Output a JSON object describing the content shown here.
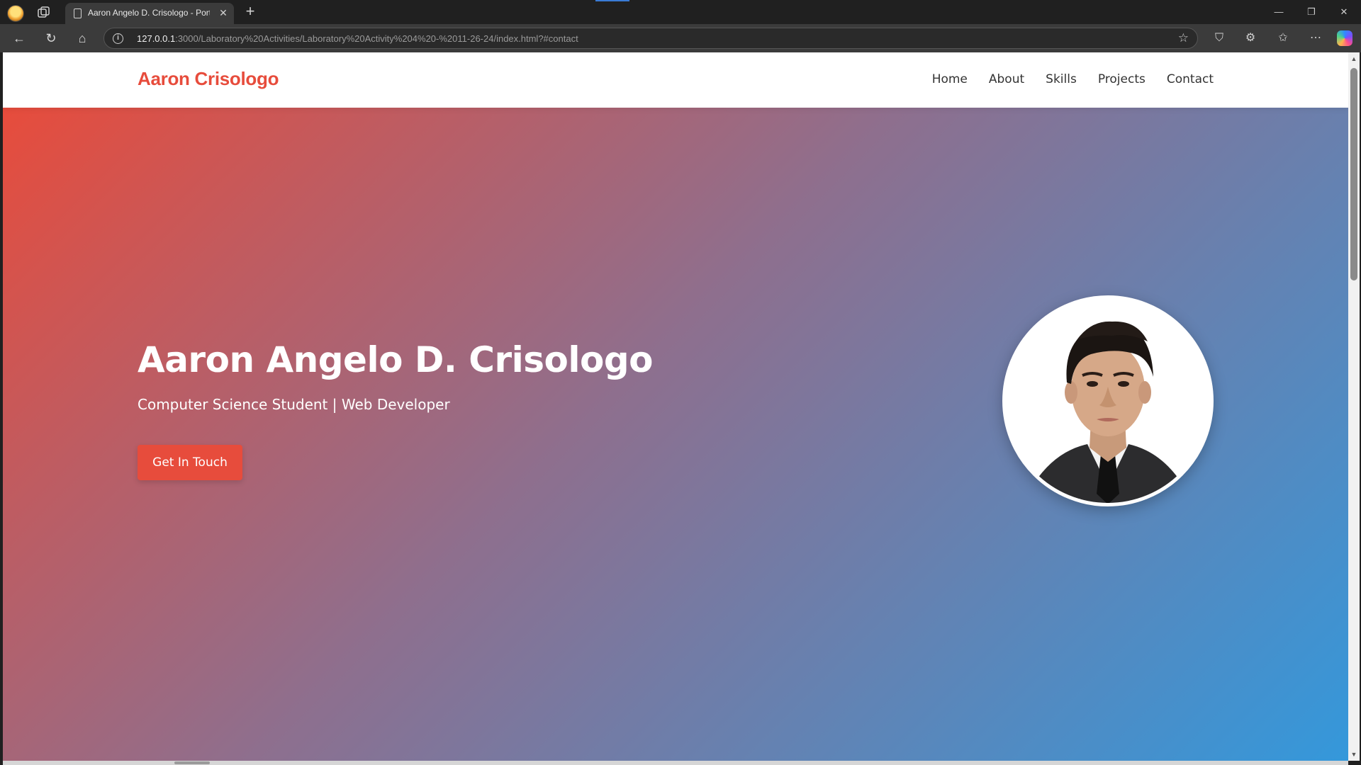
{
  "browser": {
    "tab_title": "Aaron Angelo D. Crisologo - Portfolio",
    "url_host": "127.0.0.1",
    "url_rest": ":3000/Laboratory%20Activities/Laboratory%20Activity%204%20-%2011-26-24/index.html?#contact",
    "new_tab_icon": "plus-icon",
    "close_tab_icon": "close-icon"
  },
  "site": {
    "logo": "Aaron Crisologo",
    "nav": [
      "Home",
      "About",
      "Skills",
      "Projects",
      "Contact"
    ],
    "hero": {
      "title": "Aaron Angelo D. Crisologo",
      "subtitle": "Computer Science Student | Web Developer",
      "cta_label": "Get In Touch"
    }
  },
  "colors": {
    "accent": "#e74c3c",
    "gradient_start": "#e74c3c",
    "gradient_end": "#3498db",
    "header_bg": "#ffffff"
  }
}
